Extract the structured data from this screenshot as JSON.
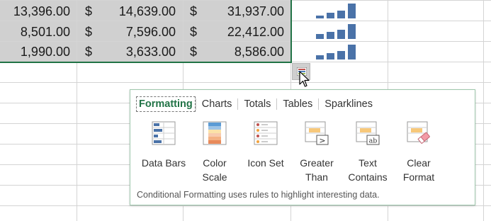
{
  "sheet": {
    "rows": [
      {
        "c1": "13,396.00",
        "s2": "$",
        "c2": "14,639.00",
        "s3": "$",
        "c3": "31,937.00"
      },
      {
        "c1": "8,501.00",
        "s2": "$",
        "c2": "7,596.00",
        "s3": "$",
        "c3": "22,412.00"
      },
      {
        "c1": "1,990.00",
        "s2": "$",
        "c2": "3,633.00",
        "s3": "$",
        "c3": "8,586.00"
      }
    ],
    "sparklines": [
      {
        "values": [
          0.2,
          0.35,
          0.5,
          0.95
        ]
      },
      {
        "values": [
          0.3,
          0.45,
          0.6,
          0.95
        ]
      },
      {
        "values": [
          0.25,
          0.4,
          0.55,
          0.95
        ]
      }
    ],
    "selection_color": "#217346",
    "sparkline_color": "#4a72a8"
  },
  "quick_analysis": {
    "tabs": [
      "Formatting",
      "Charts",
      "Totals",
      "Tables",
      "Sparklines"
    ],
    "active_tab": "Formatting",
    "tools": [
      {
        "label_1": "Data Bars",
        "label_2": "",
        "icon": "data-bars-icon"
      },
      {
        "label_1": "Color",
        "label_2": "Scale",
        "icon": "color-scale-icon"
      },
      {
        "label_1": "Icon Set",
        "label_2": "",
        "icon": "icon-set-icon"
      },
      {
        "label_1": "Greater",
        "label_2": "Than",
        "icon": "greater-than-icon"
      },
      {
        "label_1": "Text",
        "label_2": "Contains",
        "icon": "text-contains-icon"
      },
      {
        "label_1": "Clear",
        "label_2": "Format",
        "icon": "clear-format-icon"
      }
    ],
    "footer": "Conditional Formatting uses rules to highlight interesting data."
  }
}
